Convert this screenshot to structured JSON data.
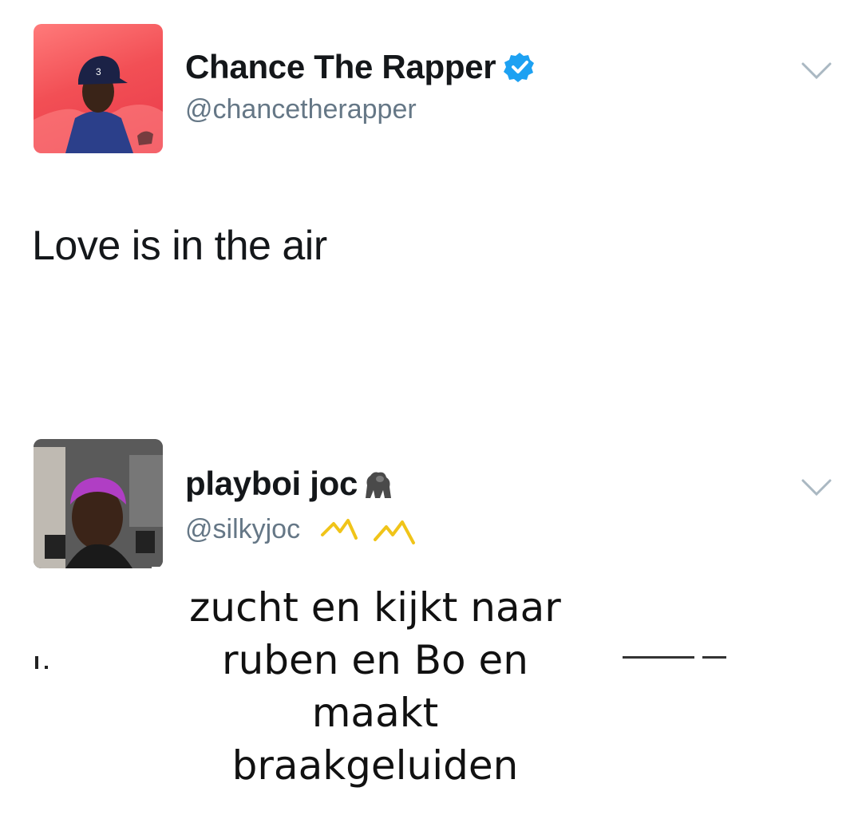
{
  "tweets": [
    {
      "display_name": "Chance The Rapper",
      "handle": "@chancetherapper",
      "verified": true,
      "text": "Love is in the air",
      "avatar_icon": "chance-avatar-photo",
      "hat_number": "3"
    },
    {
      "display_name": "playboi joc",
      "name_emoji": "gorilla-icon",
      "handle": "@silkyjoc",
      "handle_emoji": "crown-icons",
      "avatar_icon": "joc-avatar-photo"
    }
  ],
  "caption": {
    "lines": [
      "zucht en kijkt naar",
      "ruben en Bo en",
      "maakt",
      "braakgeluiden"
    ]
  },
  "colors": {
    "name": "#14171a",
    "handle": "#657786",
    "verified_blue": "#1da1f2",
    "chevron": "#aab8c2",
    "crown_yellow": "#f0c419"
  }
}
